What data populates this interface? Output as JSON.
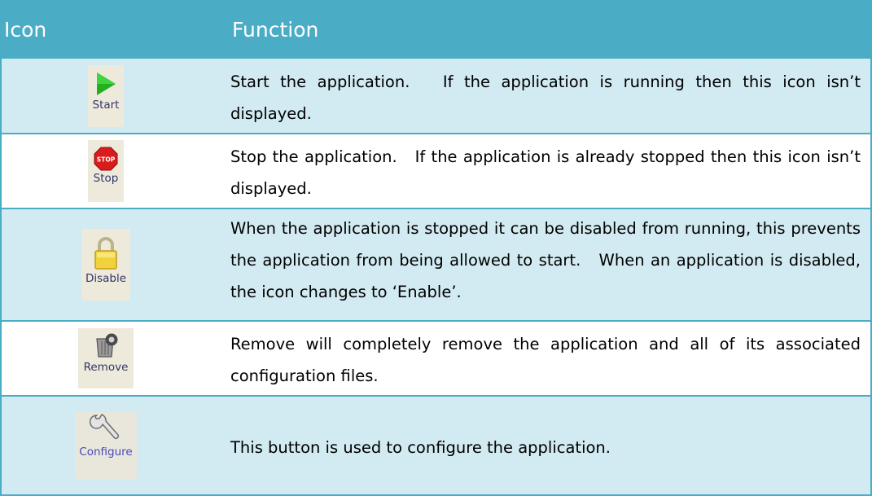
{
  "header": {
    "icon_col": "Icon",
    "function_col": "Function"
  },
  "rows": [
    {
      "icon": "play-icon",
      "icon_label": "Start",
      "description": "Start the application.   If the application is running then this icon isn’t displayed."
    },
    {
      "icon": "stop-sign-icon",
      "icon_label": "Stop",
      "stop_text": "STOP",
      "description": "Stop the application.   If the application is already stopped then this icon isn’t displayed."
    },
    {
      "icon": "padlock-icon",
      "icon_label": "Disable",
      "description": "When the application is stopped it can be disabled from running, this prevents the application from being allowed to start.   When an application is disabled, the icon changes to ‘Enable’."
    },
    {
      "icon": "trash-bin-icon",
      "icon_label": "Remove",
      "description": "Remove will completely remove the application and all of its associated configuration files."
    },
    {
      "icon": "wrench-icon",
      "icon_label": "Configure",
      "description": "This button is used to configure the application."
    }
  ],
  "colors": {
    "header_bg": "#4bacc6",
    "shaded_row": "#d2eaf1",
    "border": "#4bacc6"
  }
}
